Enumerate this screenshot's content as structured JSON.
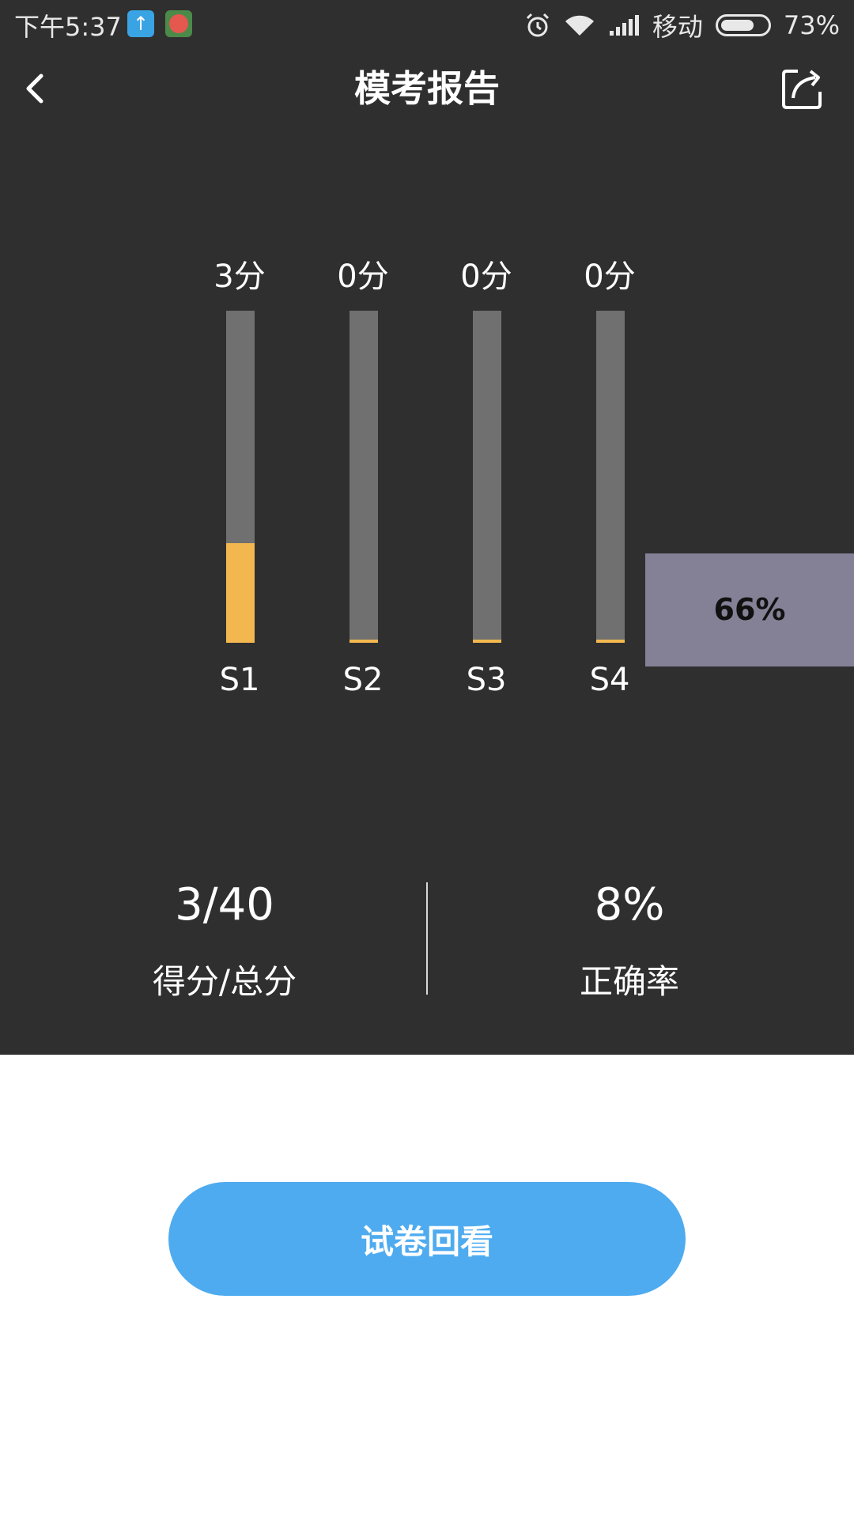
{
  "status_bar": {
    "time": "下午5:37",
    "carrier": "移动",
    "battery_percent": "73%",
    "battery_level": 0.73,
    "icons": [
      "upload-app-icon",
      "app-icon",
      "alarm-icon",
      "wifi-icon",
      "signal-icon",
      "battery-icon"
    ]
  },
  "header": {
    "title": "模考报告",
    "back_icon": "chevron-left-icon",
    "share_icon": "share-icon"
  },
  "chart_data": {
    "type": "bar",
    "categories": [
      "S1",
      "S2",
      "S3",
      "S4"
    ],
    "score_labels": [
      "3分",
      "0分",
      "0分",
      "0分"
    ],
    "values": [
      0.3,
      0.01,
      0.01,
      0.01
    ],
    "ylim": [
      0,
      1
    ],
    "colors": {
      "fill": "#f2b84f",
      "track": "#707070"
    }
  },
  "percent_tag": "66%",
  "summary": {
    "score_value": "3/40",
    "score_label": "得分/总分",
    "accuracy_value": "8%",
    "accuracy_label": "正确率"
  },
  "actions": {
    "review_label": "试卷回看"
  },
  "colors": {
    "panel_bg": "#2f2f2f",
    "accent": "#4eabf0",
    "tag_bg": "#848196"
  }
}
